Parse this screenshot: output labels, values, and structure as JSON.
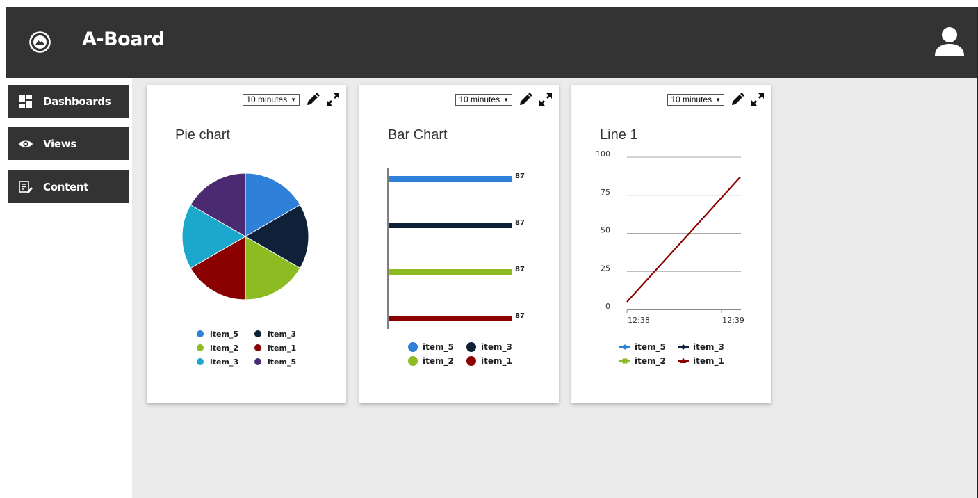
{
  "app": {
    "title": "A-Board"
  },
  "sidebar": {
    "items": [
      {
        "label": "Dashboards",
        "icon": "dashboard-icon"
      },
      {
        "label": "Views",
        "icon": "eye-icon"
      },
      {
        "label": "Content",
        "icon": "content-icon"
      }
    ]
  },
  "colors": {
    "header": "#333333",
    "background": "#ebebeb",
    "item_5": "#2f80d8",
    "item_3_dark": "#0e2138",
    "item_2": "#8dbc22",
    "item_1": "#8b0000",
    "item_3_light": "#1ca8cc",
    "item_5_purple": "#4a2a70"
  },
  "cards": [
    {
      "time_range": "10 minutes",
      "title": "Pie chart"
    },
    {
      "time_range": "10 minutes",
      "title": "Bar Chart"
    },
    {
      "time_range": "10 minutes",
      "title": "Line 1"
    }
  ],
  "chart_data": [
    {
      "type": "pie",
      "title": "Pie chart",
      "slices": [
        {
          "name": "item_5",
          "value": 1,
          "color": "#2f80d8"
        },
        {
          "name": "item_3",
          "value": 1,
          "color": "#0e2138"
        },
        {
          "name": "item_2",
          "value": 1,
          "color": "#8dbc22"
        },
        {
          "name": "item_1",
          "value": 1,
          "color": "#8b0000"
        },
        {
          "name": "item_3",
          "value": 1,
          "color": "#1ca8cc"
        },
        {
          "name": "item_5",
          "value": 1,
          "color": "#4a2a70"
        }
      ],
      "legend": "bottom"
    },
    {
      "type": "bar",
      "orientation": "horizontal",
      "title": "Bar Chart",
      "series": [
        {
          "name": "item_5",
          "value": 87,
          "color": "#2f80d8"
        },
        {
          "name": "item_3",
          "value": 87,
          "color": "#0e2138"
        },
        {
          "name": "item_2",
          "value": 87,
          "color": "#8dbc22"
        },
        {
          "name": "item_1",
          "value": 87,
          "color": "#8b0000"
        }
      ],
      "data_labels": true,
      "legend": "bottom"
    },
    {
      "type": "line",
      "title": "Line 1",
      "x_ticks": [
        "12:38",
        "12:39"
      ],
      "y_ticks": [
        0,
        25,
        50,
        75,
        100
      ],
      "ylim": [
        0,
        100
      ],
      "grid": true,
      "series": [
        {
          "name": "item_5",
          "color": "#2f80d8",
          "marker": "circle",
          "points": []
        },
        {
          "name": "item_3",
          "color": "#0e2138",
          "marker": "diamond",
          "points": []
        },
        {
          "name": "item_2",
          "color": "#8dbc22",
          "marker": "square",
          "points": []
        },
        {
          "name": "item_1",
          "color": "#8b0000",
          "marker": "triangle",
          "points": [
            {
              "x": "12:38",
              "y": 5
            },
            {
              "x": "12:39",
              "y": 87
            }
          ]
        }
      ],
      "legend": "bottom"
    }
  ]
}
